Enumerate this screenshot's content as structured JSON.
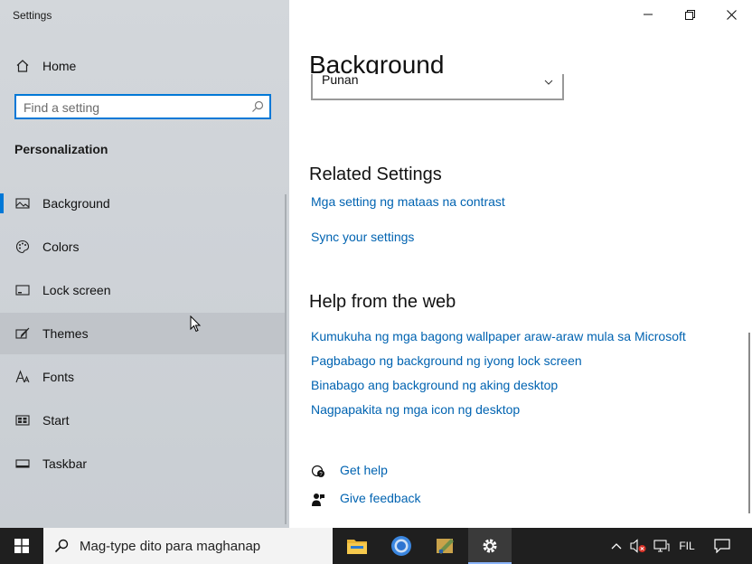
{
  "window": {
    "app_title": "Settings"
  },
  "sidebar": {
    "home_label": "Home",
    "search_placeholder": "Find a setting",
    "section_title": "Personalization",
    "items": [
      {
        "label": "Background",
        "icon": "picture-icon",
        "selected": true
      },
      {
        "label": "Colors",
        "icon": "palette-icon"
      },
      {
        "label": "Lock screen",
        "icon": "lock-screen-icon"
      },
      {
        "label": "Themes",
        "icon": "themes-icon",
        "hover": true
      },
      {
        "label": "Fonts",
        "icon": "fonts-icon"
      },
      {
        "label": "Start",
        "icon": "start-icon"
      },
      {
        "label": "Taskbar",
        "icon": "taskbar-icon"
      }
    ]
  },
  "main": {
    "title": "Background",
    "dropdown_value": "Punan",
    "related_settings": {
      "heading": "Related Settings",
      "links": [
        "Mga setting ng mataas na contrast",
        "Sync your settings"
      ]
    },
    "help": {
      "heading": "Help from the web",
      "links": [
        "Kumukuha ng mga bagong wallpaper araw-araw mula sa Microsoft",
        "Pagbabago ng background ng iyong lock screen",
        "Binabago ang background ng aking desktop",
        "Nagpapakita ng mga icon ng desktop"
      ]
    },
    "get_help": "Get help",
    "give_feedback": "Give feedback"
  },
  "taskbar": {
    "search_placeholder": "Mag-type dito para maghanap",
    "language": "FIL",
    "apps": [
      "file-explorer-icon",
      "chrome-icon",
      "paint-icon",
      "settings-icon"
    ]
  },
  "colors": {
    "accent": "#0078d7",
    "link": "#0063b1",
    "taskbar": "#1f1f1f"
  }
}
